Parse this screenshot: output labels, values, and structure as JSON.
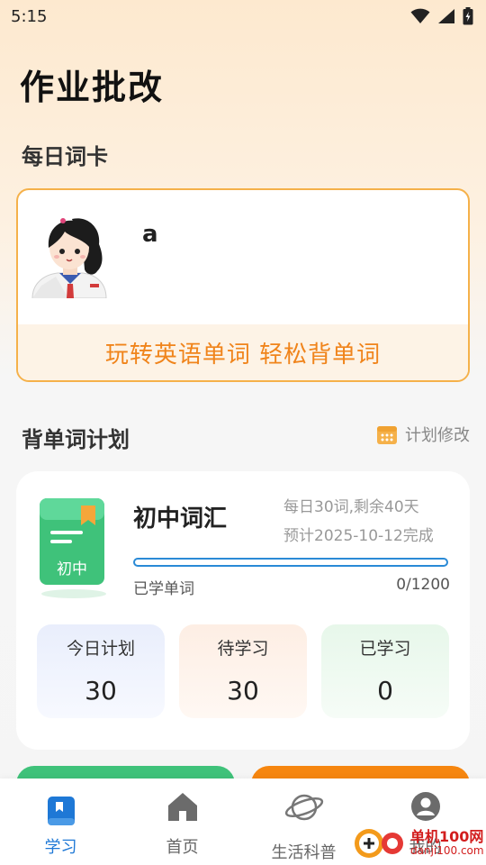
{
  "status_bar": {
    "time": "5:15"
  },
  "app_title": "作业批改",
  "daily_card": {
    "title": "每日词卡",
    "word": "a",
    "slogan": "玩转英语单词  轻松背单词"
  },
  "plan_section": {
    "title": "背单词计划",
    "edit_label": "计划修改",
    "book_label": "初中",
    "plan_name": "初中词汇",
    "daily_info": "每日30词,剩余40天",
    "eta_info": "预计2025-10-12完成",
    "progress_fraction": 0,
    "learned_label": "已学单词",
    "learned_count": "0/1200",
    "stats": {
      "today": {
        "label": "今日计划",
        "value": "30"
      },
      "pending": {
        "label": "待学习",
        "value": "30"
      },
      "done": {
        "label": "已学习",
        "value": "0"
      }
    }
  },
  "bottom_nav": {
    "items": [
      {
        "label": "学习",
        "icon": "book-icon",
        "active": true
      },
      {
        "label": "首页",
        "icon": "home-icon",
        "active": false
      },
      {
        "label": "生活科普",
        "icon": "planet-icon",
        "active": false
      },
      {
        "label": "我的",
        "icon": "user-icon",
        "active": false
      }
    ]
  },
  "watermark": {
    "text": "单机100网",
    "sub": "danji100.com"
  },
  "colors": {
    "accent_orange": "#f0841b",
    "accent_blue": "#1e78d6",
    "card_border": "#f5b14a",
    "book_green": "#3fc27a"
  }
}
